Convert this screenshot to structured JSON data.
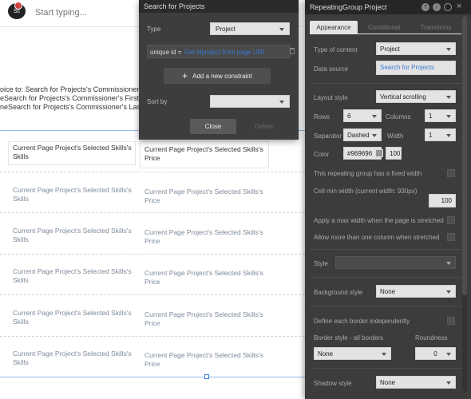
{
  "topbar": {
    "search_placeholder": "Start typing...",
    "logo_text": "Sc"
  },
  "canvas": {
    "lines": [
      "oice to: Search for Projects's Commissioner's",
      "eSearch for Projects's Commissioner's First",
      "neSearch for Projects's Commissioner's Last N"
    ],
    "cell_left": "Current Page Project's Selected Skills's Skills",
    "cell_right": "Current Page Project's Selected Skills's Price"
  },
  "search_dialog": {
    "title": "Search for Projects",
    "type_label": "Type",
    "type_value": "Project",
    "constraint_key": "unique id =",
    "constraint_value": "Get idproject from page URL",
    "add_constraint": "Add a new constraint",
    "sort_label": "Sort by",
    "sort_value": "",
    "close": "Close",
    "delete": "Delete"
  },
  "panel": {
    "title": "RepeatingGroup Project",
    "tabs": [
      "Appearance",
      "Conditional",
      "Transitions"
    ],
    "type_of_content_label": "Type of content",
    "type_of_content": "Project",
    "data_source_label": "Data source",
    "data_source": "Search for Projects",
    "layout_style_label": "Layout style",
    "layout_style": "Vertical scrolling",
    "rows_label": "Rows",
    "rows": "6",
    "columns_label": "Columns",
    "columns": "1",
    "separator_label": "Separator",
    "separator": "Dashed",
    "width_label": "Width",
    "width": "1",
    "color_label": "Color",
    "color_hex": "#969696",
    "color_value": "100",
    "fixed_width_label": "This repeating group has a fixed width",
    "cell_min_width_label": "Cell min width (current width: 930px)",
    "cell_min_width": "100",
    "max_width_label": "Apply a max width when the page is stretched",
    "multi_col_label": "Allow more than one column when stretched",
    "style_label": "Style",
    "style_value": "",
    "bg_style_label": "Background style",
    "bg_style": "None",
    "border_indep_label": "Define each border independently",
    "border_style_label": "Border style - all borders",
    "roundness_label": "Roundness",
    "border_style": "None",
    "roundness": "0",
    "shadow_label": "Shadow style",
    "shadow": "None"
  },
  "colors": {
    "swatch": "#969696",
    "link": "#3a7bd5"
  }
}
